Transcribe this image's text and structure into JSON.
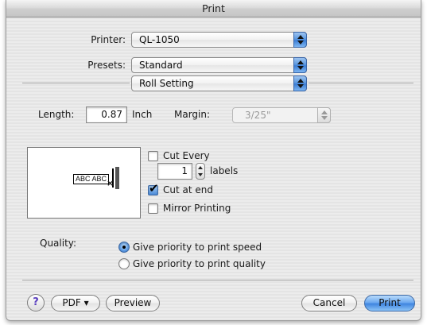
{
  "window": {
    "title": "Print"
  },
  "printer": {
    "label": "Printer:",
    "value": "QL-1050"
  },
  "presets": {
    "label": "Presets:",
    "value": "Standard"
  },
  "section": {
    "value": "Roll Setting"
  },
  "length": {
    "label": "Length:",
    "value": "0.87",
    "unit": "Inch"
  },
  "margin": {
    "label": "Margin:",
    "value": "3/25\""
  },
  "preview": {
    "sample_text": "ABC ABC",
    "cut_mark": "×"
  },
  "cut_every": {
    "label": "Cut Every",
    "checked": false,
    "count": "1",
    "unit": "labels"
  },
  "cut_at_end": {
    "label": "Cut at end",
    "checked": true
  },
  "mirror_printing": {
    "label": "Mirror Printing",
    "checked": false
  },
  "quality": {
    "label": "Quality:",
    "options": [
      {
        "label": "Give priority to print speed",
        "selected": true
      },
      {
        "label": "Give priority to print quality",
        "selected": false
      }
    ]
  },
  "buttons": {
    "help": "?",
    "pdf": "PDF ▾",
    "preview": "Preview",
    "cancel": "Cancel",
    "print": "Print"
  },
  "colors": {
    "accent": "#3f85e0",
    "check": "#4a8ad8"
  }
}
